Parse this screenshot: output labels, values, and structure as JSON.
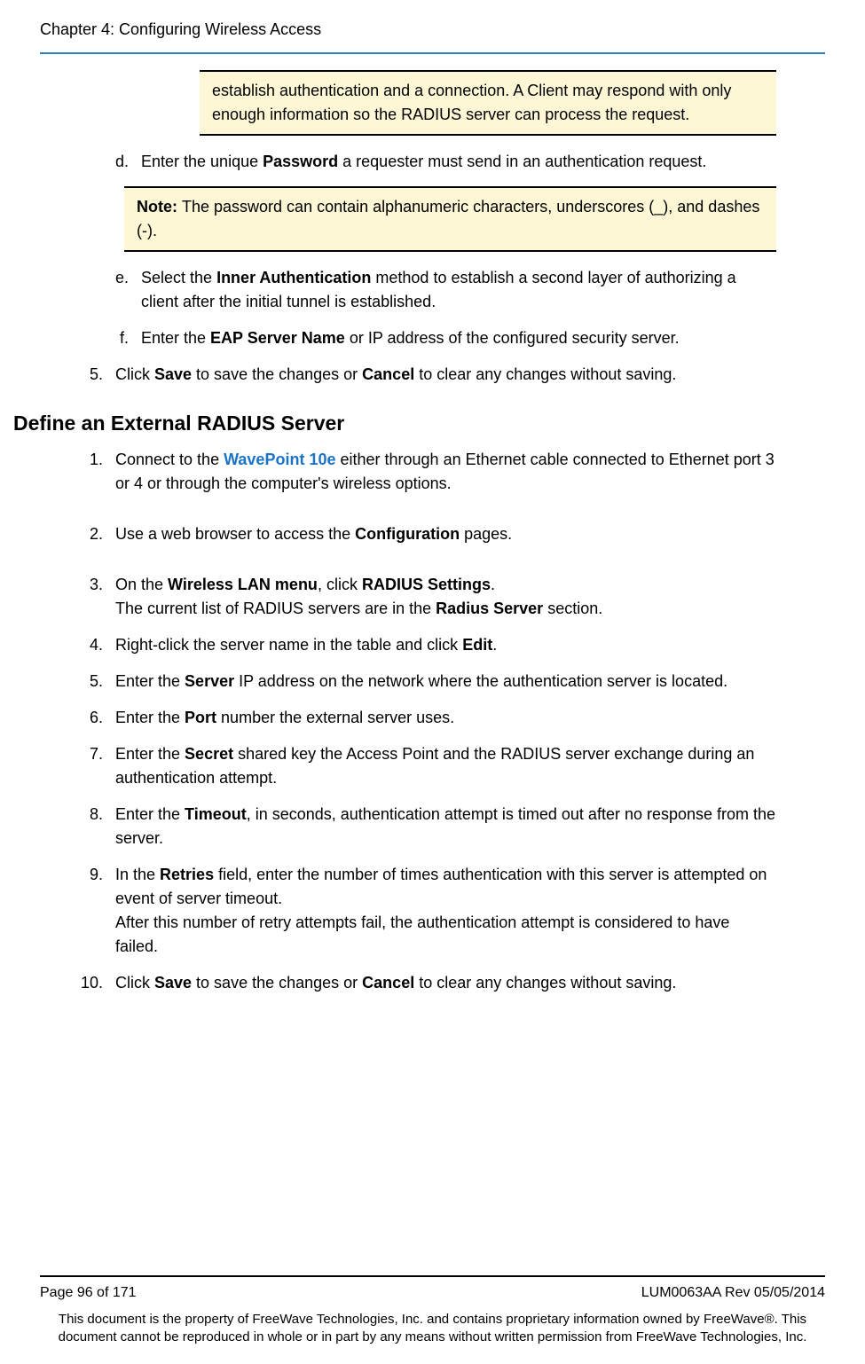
{
  "header": {
    "chapter": "Chapter 4: Configuring Wireless Access"
  },
  "top_note_continued": "establish authentication and a connection.\nA Client may respond with only enough information so the RADIUS server can process the request.",
  "steps_letter": {
    "d": {
      "marker": "d.",
      "pre": "Enter the unique ",
      "bold1": "Password",
      "post": " a requester must send in an authentication request."
    },
    "d_note": {
      "label": "Note: ",
      "text": "The password can contain alphanumeric characters, underscores (_), and dashes (-)."
    },
    "e": {
      "marker": "e.",
      "pre": "Select the ",
      "bold1": "Inner Authentication",
      "post": " method to establish a second layer of authorizing a client after the initial tunnel is established."
    },
    "f": {
      "marker": "f.",
      "pre": "Enter the ",
      "bold1": "EAP Server Name",
      "post": " or IP address of the configured security server."
    }
  },
  "step5": {
    "marker": "5.",
    "pre": "Click ",
    "bold1": "Save",
    "mid": " to save the changes or ",
    "bold2": "Cancel",
    "post": " to clear any changes without saving."
  },
  "section_title": "Define an External RADIUS Server",
  "ext": {
    "s1": {
      "marker": "1.",
      "pre": "Connect to the ",
      "link": "WavePoint 10e",
      "post": " either through an Ethernet cable connected to Ethernet port 3 or 4 or through the computer's wireless options."
    },
    "s2": {
      "marker": "2.",
      "pre": "Use a web browser to access the ",
      "bold1": "Configuration",
      "post": " pages."
    },
    "s3": {
      "marker": "3.",
      "pre": "On the ",
      "bold1": "Wireless LAN menu",
      "mid": ", click ",
      "bold2": "RADIUS Settings",
      "post": ".",
      "line2_pre": "The current list of RADIUS servers are in the ",
      "line2_bold": "Radius Server",
      "line2_post": " section."
    },
    "s4": {
      "marker": "4.",
      "pre": "Right-click the server name in the table and click ",
      "bold1": "Edit",
      "post": "."
    },
    "s5": {
      "marker": "5.",
      "pre": "Enter the ",
      "bold1": "Server",
      "post": " IP address on the network where the authentication server is located."
    },
    "s6": {
      "marker": "6.",
      "pre": "Enter the ",
      "bold1": "Port",
      "post": " number the external server uses."
    },
    "s7": {
      "marker": "7.",
      "pre": "Enter the ",
      "bold1": "Secret",
      "post": " shared key the Access Point and the RADIUS server exchange during an authentication attempt."
    },
    "s8": {
      "marker": "8.",
      "pre": "Enter the ",
      "bold1": "Timeout",
      "post": ", in seconds, authentication attempt is timed out after no response from the server."
    },
    "s9": {
      "marker": "9.",
      "line1_pre": "In the ",
      "line1_bold": "Retries",
      "line1_post": " field, enter the number of times authentication with this server is attempted on event of server timeout.",
      "line2": "After this number of retry attempts fail, the authentication attempt is considered to have failed."
    },
    "s10": {
      "marker": "10.",
      "pre": "Click ",
      "bold1": "Save",
      "mid": " to save the changes or ",
      "bold2": "Cancel",
      "post": " to clear any changes without saving."
    }
  },
  "footer": {
    "page": "Page 96 of 171",
    "docref": "LUM0063AA Rev 05/05/2014",
    "legal": "This document is the property of FreeWave Technologies, Inc. and contains proprietary information owned by FreeWave®. This document cannot be reproduced in whole or in part by any means without written permission from FreeWave Technologies, Inc."
  }
}
